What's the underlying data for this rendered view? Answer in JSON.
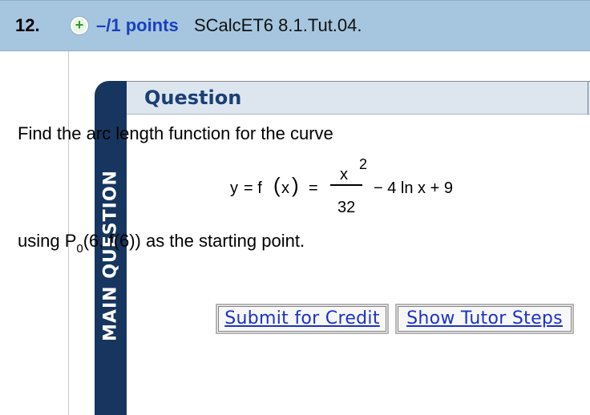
{
  "header": {
    "question_number": "12.",
    "points": "–/1 points",
    "code": "SCalcET6 8.1.Tut.04."
  },
  "tab_label": "MAIN QUESTION",
  "question": {
    "title": "Question",
    "prompt": "Find the arc length function for the curve",
    "equation": {
      "lhs_y": "y",
      "eq1": "= f",
      "var": "x",
      "eq2": "=",
      "numerator": "x",
      "exponent": "2",
      "denominator": "32",
      "rest": "− 4 ln x + 9"
    },
    "starting_point": {
      "before": "using P",
      "sub": "0",
      "after": "(6, f(6)) as the starting point."
    }
  },
  "buttons": {
    "submit": "Submit for Credit",
    "tutor": "Show Tutor Steps"
  }
}
